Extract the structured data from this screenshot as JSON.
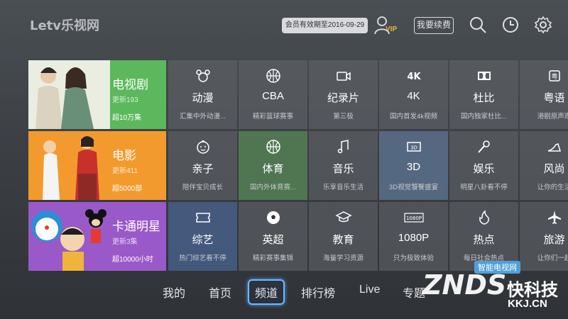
{
  "header": {
    "logo": "Letv乐视网",
    "vip_expiry": "会员有效期至2016-09-29",
    "vip_label": "VIP",
    "renew_label": "我要续费",
    "icons": [
      "user-icon",
      "search-icon",
      "clock-icon",
      "gear-icon"
    ]
  },
  "featured": [
    {
      "title": "电视剧",
      "sub": "更新193",
      "count": "超10万集",
      "color": "#5cb85c"
    },
    {
      "title": "电影",
      "sub": "更新411",
      "count": "超5000部",
      "color": "#f39a2e"
    },
    {
      "title": "卡通明星",
      "sub": "更新3集",
      "count": "超10000小时",
      "color": "#9a59c8"
    }
  ],
  "tiles": [
    [
      {
        "name": "动漫",
        "desc": "汇集中外动漫...",
        "icon": "mickey-icon"
      },
      {
        "name": "CBA",
        "desc": "精彩篮球赛事",
        "icon": "basketball-icon"
      },
      {
        "name": "纪录片",
        "desc": "第三极",
        "icon": "camera-icon"
      },
      {
        "name": "4K",
        "desc": "国内首发4k视频",
        "icon": "4k-icon"
      },
      {
        "name": "杜比",
        "desc": "国内独家杜比...",
        "icon": "dolby-icon"
      },
      {
        "name": "粤语",
        "desc": "港剧原声观",
        "icon": "cantonese-icon"
      }
    ],
    [
      {
        "name": "亲子",
        "desc": "陪伴宝贝成长",
        "icon": "baby-icon"
      },
      {
        "name": "体育",
        "desc": "国内外体育赛...",
        "icon": "ball-icon"
      },
      {
        "name": "音乐",
        "desc": "乐享音乐生活",
        "icon": "music-note-icon"
      },
      {
        "name": "3D",
        "desc": "3D视觉饕餮盛宴",
        "icon": "3d-icon"
      },
      {
        "name": "娱乐",
        "desc": "明星八卦看不停",
        "icon": "microphone-icon"
      },
      {
        "name": "风尚",
        "desc": "让你的生活",
        "icon": "high-heel-icon"
      }
    ],
    [
      {
        "name": "综艺",
        "desc": "热门综艺看不停",
        "icon": "ticket-icon"
      },
      {
        "name": "英超",
        "desc": "精彩赛事集锦",
        "icon": "soccer-icon"
      },
      {
        "name": "教育",
        "desc": "海量学习资源",
        "icon": "graduation-cap-icon"
      },
      {
        "name": "1080P",
        "desc": "只为极致体验",
        "icon": "1080p-icon"
      },
      {
        "name": "热点",
        "desc": "每日社会热点",
        "icon": "flame-icon"
      },
      {
        "name": "旅游",
        "desc": "让你们一起",
        "icon": "airplane-icon"
      }
    ]
  ],
  "nav": {
    "items": [
      "我的",
      "首页",
      "频道",
      "排行榜",
      "Live",
      "专题"
    ],
    "active": "频道"
  },
  "watermark": {
    "tag": "智能电视网",
    "brand": "ZNDS",
    "cn": "快科技",
    "url": "KKJ.CN"
  }
}
